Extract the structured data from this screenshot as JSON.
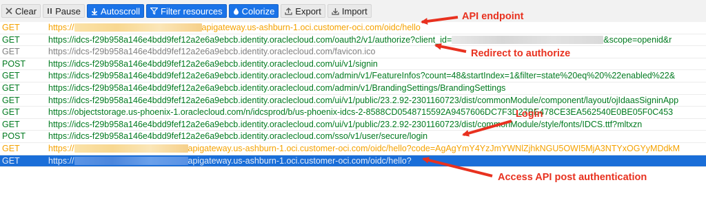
{
  "toolbar": {
    "clear": "Clear",
    "pause": "Pause",
    "autoscroll": "Autoscroll",
    "filter": "Filter resources",
    "colorize": "Colorize",
    "export": "Export",
    "import": "Import",
    "active_color": "#1a73e8"
  },
  "requests": [
    {
      "method": "GET",
      "pre": "https://",
      "post": "apigateway.us-ashburn-1.oci.customer-oci.com/oidc/hello",
      "color": "orange",
      "redacted": true
    },
    {
      "method": "GET",
      "pre": "https://idcs-f29b958a146e4bdd9fef12a2e6a9ebcb.identity.oraclecloud.com/oauth2/v1/authorize?client_id=",
      "post": "&scope=openid&r",
      "color": "green",
      "redacted": true
    },
    {
      "method": "GET",
      "pre": "https://idcs-f29b958a146e4bdd9fef12a2e6a9ebcb.identity.oraclecloud.com/favicon.ico",
      "post": "",
      "color": "gray",
      "redacted": false
    },
    {
      "method": "POST",
      "pre": "https://idcs-f29b958a146e4bdd9fef12a2e6a9ebcb.identity.oraclecloud.com/ui/v1/signin",
      "post": "",
      "color": "green",
      "redacted": false
    },
    {
      "method": "GET",
      "pre": "https://idcs-f29b958a146e4bdd9fef12a2e6a9ebcb.identity.oraclecloud.com/admin/v1/FeatureInfos?count=48&startIndex=1&filter=state%20eq%20%22enabled%22&",
      "post": "",
      "color": "green",
      "redacted": false
    },
    {
      "method": "GET",
      "pre": "https://idcs-f29b958a146e4bdd9fef12a2e6a9ebcb.identity.oraclecloud.com/admin/v1/BrandingSettings/BrandingSettings",
      "post": "",
      "color": "green",
      "redacted": false
    },
    {
      "method": "GET",
      "pre": "https://idcs-f29b958a146e4bdd9fef12a2e6a9ebcb.identity.oraclecloud.com/ui/v1/public/23.2.92-2301160723/dist/commonModule/component/layout/ojIdaasSigninApp",
      "post": "",
      "color": "green",
      "redacted": false
    },
    {
      "method": "GET",
      "pre": "https://objectstorage.us-phoenix-1.oraclecloud.com/n/idcsprod/b/us-phoenix-idcs-2-8588CD0548715592A9457606DC7F3D27BE478CE3EA562540E0BE05F0C453",
      "post": "",
      "color": "green",
      "redacted": false
    },
    {
      "method": "GET",
      "pre": "https://idcs-f29b958a146e4bdd9fef12a2e6a9ebcb.identity.oraclecloud.com/ui/v1/public/23.2.92-2301160723/dist/commonModule/style/fonts/IDCS.ttf?mltxzn",
      "post": "",
      "color": "green",
      "redacted": false
    },
    {
      "method": "POST",
      "pre": "https://idcs-f29b958a146e4bdd9fef12a2e6a9ebcb.identity.oraclecloud.com/sso/v1/user/secure/login",
      "post": "",
      "color": "green",
      "redacted": false
    },
    {
      "method": "GET",
      "pre": "https://",
      "post": "apigateway.us-ashburn-1.oci.customer-oci.com/oidc/hello?code=AgAgYmY4YzJmYWNlZjhkNGU5OWI5MjA3NTYxOGYyMDdkM",
      "color": "orange",
      "redacted": true
    },
    {
      "method": "GET",
      "pre": "https://",
      "post": "apigateway.us-ashburn-1.oci.customer-oci.com/oidc/hello?",
      "color": "selected",
      "redacted": true
    }
  ],
  "annotations": {
    "api_endpoint": "API endpoint",
    "redirect": "Redirect to authorize",
    "login": "Login",
    "access": "Access API post authentication",
    "color": "#e8311f"
  }
}
